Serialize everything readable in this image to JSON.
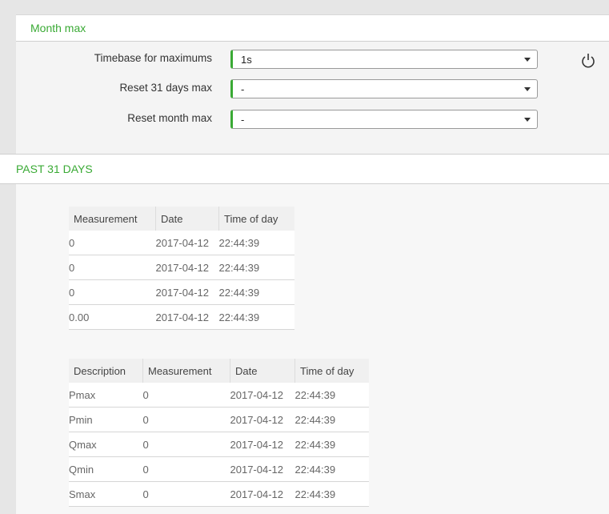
{
  "month_max": {
    "title": "Month max",
    "fields": [
      {
        "label": "Timebase for maximums",
        "value": "1s"
      },
      {
        "label": "Reset 31 days max",
        "value": "-"
      },
      {
        "label": "Reset month max",
        "value": "-"
      }
    ],
    "power_icon": "power-icon"
  },
  "past": {
    "title": "PAST 31 DAYS",
    "table1": {
      "headers": [
        "Measurement",
        "Date",
        "Time of day"
      ],
      "rows": [
        [
          "0",
          "2017-04-12",
          "22:44:39"
        ],
        [
          "0",
          "2017-04-12",
          "22:44:39"
        ],
        [
          "0",
          "2017-04-12",
          "22:44:39"
        ],
        [
          "0.00",
          "2017-04-12",
          "22:44:39"
        ]
      ]
    },
    "table2": {
      "headers": [
        "Description",
        "Measurement",
        "Date",
        "Time of day"
      ],
      "rows": [
        [
          "Pmax",
          "0",
          "2017-04-12",
          "22:44:39"
        ],
        [
          "Pmin",
          "0",
          "2017-04-12",
          "22:44:39"
        ],
        [
          "Qmax",
          "0",
          "2017-04-12",
          "22:44:39"
        ],
        [
          "Qmin",
          "0",
          "2017-04-12",
          "22:44:39"
        ],
        [
          "Smax",
          "0",
          "2017-04-12",
          "22:44:39"
        ]
      ]
    }
  },
  "colors": {
    "accent": "#3aaa35"
  }
}
